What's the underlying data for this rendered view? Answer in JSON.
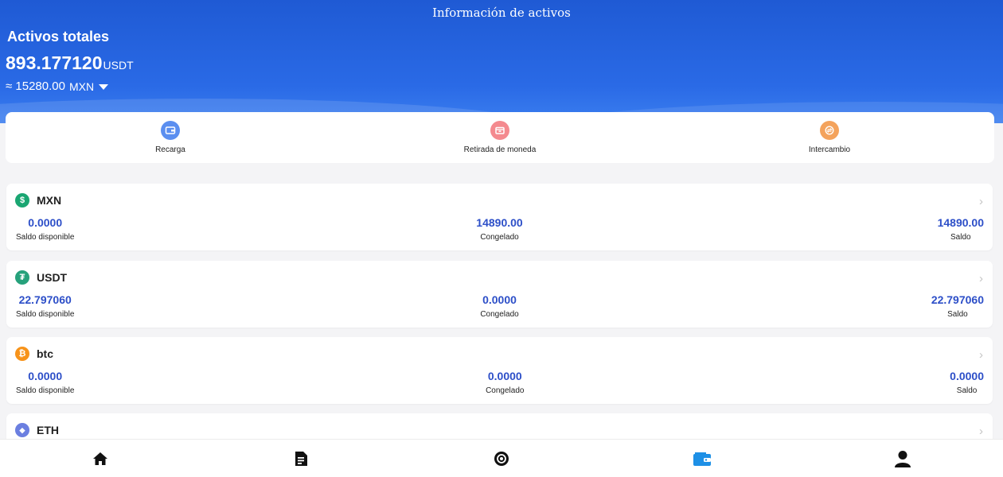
{
  "header": {
    "title": "Información de activos",
    "total_label": "Activos totales",
    "total_value": "893.177120",
    "total_unit": "USDT",
    "approx_value": "≈ 15280.00",
    "approx_currency": "MXN"
  },
  "actions": [
    {
      "label": "Recarga",
      "icon": "wallet-icon",
      "color": "#5b8ff0"
    },
    {
      "label": "Retirada de moneda",
      "icon": "withdraw-icon",
      "color": "#f48a8f"
    },
    {
      "label": "Intercambio",
      "icon": "exchange-icon",
      "color": "#f4a35c"
    }
  ],
  "assets": [
    {
      "name": "MXN",
      "icon": "dollar-icon",
      "color": "#1aa672",
      "glyph": "$",
      "available": "0.0000",
      "available_label": "Saldo disponible",
      "frozen": "14890.00",
      "frozen_label": "Congelado",
      "balance": "14890.00",
      "balance_label": "Saldo"
    },
    {
      "name": "USDT",
      "icon": "tether-icon",
      "color": "#26a17b",
      "glyph": "₮",
      "available": "22.797060",
      "available_label": "Saldo disponible",
      "frozen": "0.0000",
      "frozen_label": "Congelado",
      "balance": "22.797060",
      "balance_label": "Saldo"
    },
    {
      "name": "btc",
      "icon": "bitcoin-icon",
      "color": "#f7931a",
      "glyph": "₿",
      "available": "0.0000",
      "available_label": "Saldo disponible",
      "frozen": "0.0000",
      "frozen_label": "Congelado",
      "balance": "0.0000",
      "balance_label": "Saldo"
    },
    {
      "name": "ETH",
      "icon": "ethereum-icon",
      "color": "#6b7fe0",
      "glyph": "◆"
    }
  ],
  "tabbar": [
    {
      "icon": "home-icon",
      "active": false
    },
    {
      "icon": "document-icon",
      "active": false
    },
    {
      "icon": "market-icon",
      "active": false
    },
    {
      "icon": "wallet-icon",
      "active": true,
      "color": "#1e90e6"
    },
    {
      "icon": "user-icon",
      "active": false
    }
  ]
}
